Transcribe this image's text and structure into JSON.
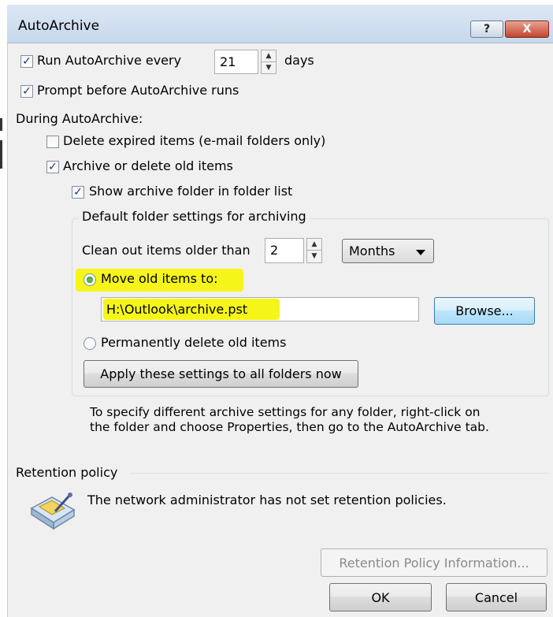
{
  "window": {
    "title": "AutoArchive",
    "help_glyph": "?",
    "close_glyph": "X"
  },
  "autoarchive": {
    "run_checked": true,
    "run_label": "Run AutoArchive every",
    "run_days_value": "21",
    "days_label": "days",
    "prompt_checked": true,
    "prompt_label": "Prompt before AutoArchive runs"
  },
  "during": {
    "heading": "During AutoArchive:",
    "delete_expired_checked": false,
    "delete_expired_label": "Delete expired items (e-mail folders only)",
    "archive_old_checked": true,
    "archive_old_label": "Archive or delete old items",
    "show_folder_checked": true,
    "show_folder_label": "Show archive folder in folder list"
  },
  "defaults": {
    "legend": "Default folder settings for archiving",
    "clean_label": "Clean out items older than",
    "clean_value": "2",
    "unit_selected": "Months",
    "move_selected": true,
    "move_label": "Move old items to:",
    "path_value": "H:\\Outlook\\archive.pst",
    "browse_label": "Browse...",
    "delete_label": "Permanently delete old items",
    "apply_label": "Apply these settings to all folders now"
  },
  "info_text": "To specify different archive settings for any folder, right-click on the folder and choose Properties, then go to the AutoArchive tab.",
  "retention": {
    "legend": "Retention policy",
    "icon": "retention-policy-icon",
    "message": "The network administrator has not set retention policies.",
    "info_button": "Retention Policy Information..."
  },
  "footer": {
    "ok_label": "OK",
    "cancel_label": "Cancel"
  },
  "colors": {
    "highlight": "#f5f51a",
    "check_mark": "#1f3b74",
    "radio_on": "#1d7d1d"
  },
  "checkmark_glyph": "✓"
}
